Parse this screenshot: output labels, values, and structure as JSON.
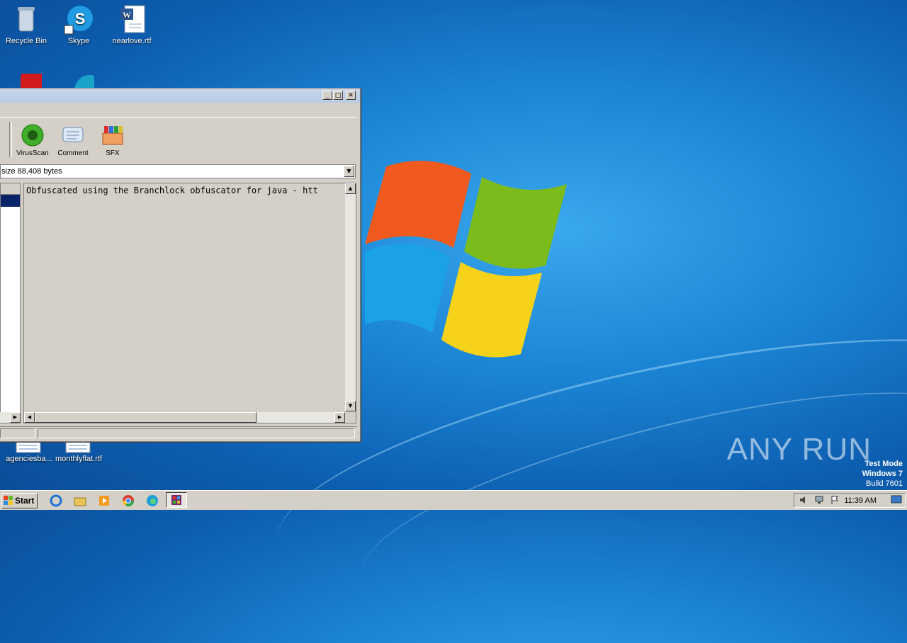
{
  "desktop": {
    "icons": [
      {
        "label": "Recycle Bin"
      },
      {
        "label": "Skype"
      },
      {
        "label": "nearlove.rtf"
      },
      {
        "label": "agenciesba..."
      },
      {
        "label": "monthlyflat.rtf"
      }
    ]
  },
  "window": {
    "toolbar": {
      "virusscan_label": "VirusScan",
      "comment_label": "Comment",
      "sfx_label": "SFX"
    },
    "address_value": "size 88,408 bytes",
    "comment_text": "Obfuscated using the Branchlock obfuscator for java - htt"
  },
  "taskbar": {
    "start_label": "Start",
    "clock": "11:39 AM"
  },
  "overlay": {
    "watermark": "ANY RUN",
    "test_mode": "Test Mode",
    "os_name": "Windows 7",
    "build": "Build 7601"
  },
  "colors": {
    "desktop_blue": "#1c86d6",
    "selection": "#0a246a",
    "window_face": "#d4d0c8"
  }
}
